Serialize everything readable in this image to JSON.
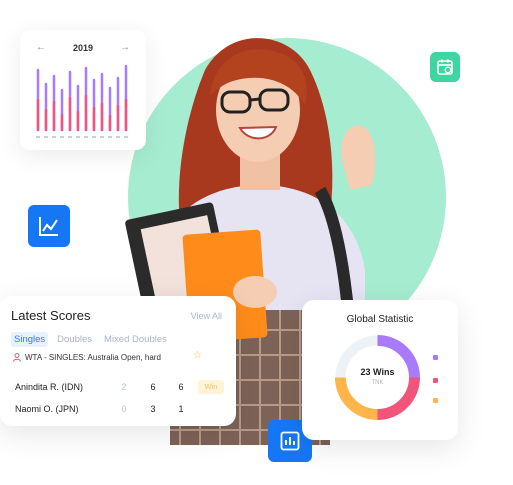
{
  "year_widget": {
    "prev": "←",
    "year": "2019",
    "next": "→"
  },
  "scores": {
    "title": "Latest Scores",
    "view_all": "View All",
    "tabs": [
      {
        "label": "Singles",
        "active": true
      },
      {
        "label": "Doubles",
        "active": false
      },
      {
        "label": "Mixed Doubles",
        "active": false
      }
    ],
    "tournament": "WTA - SINGLES: Australia Open, hard",
    "players": [
      {
        "name": "Anindita R. (IDN)",
        "scores": [
          "2",
          "6",
          "6"
        ],
        "badge": "Win"
      },
      {
        "name": "Naomi O. (JPN)",
        "scores": [
          "0",
          "3",
          "1"
        ],
        "badge": ""
      }
    ]
  },
  "statistic": {
    "title": "Global Statistic",
    "center_value": "23 Wins",
    "center_sub": "TNK"
  },
  "colors": {
    "mint": "#a6ecd0",
    "green": "#3fd5a0",
    "blue": "#1677f5",
    "purple": "#a77bfa",
    "pink": "#f2557a",
    "orange": "#ffb54a"
  },
  "icons": {
    "calendar": "calendar-icon",
    "trend": "trend-chart-icon",
    "bar": "bar-chart-icon",
    "user": "user-icon",
    "star": "star-icon"
  }
}
